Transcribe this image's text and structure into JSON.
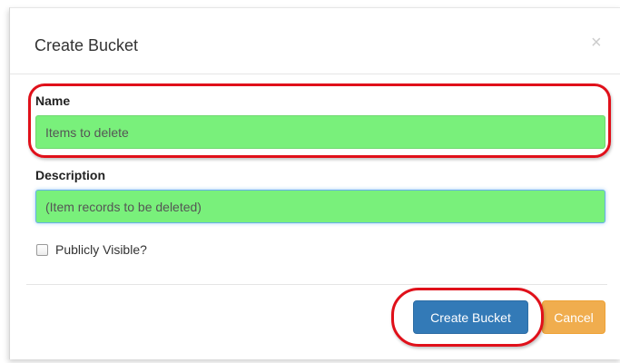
{
  "modal": {
    "title": "Create Bucket",
    "close_glyph": "×"
  },
  "form": {
    "name": {
      "label": "Name",
      "value": "Items to delete"
    },
    "description": {
      "label": "Description",
      "value": "(Item records to be deleted)"
    },
    "public": {
      "label": "Publicly Visible?",
      "checked": false
    }
  },
  "footer": {
    "create_label": "Create Bucket",
    "cancel_label": "Cancel"
  },
  "colors": {
    "field_fill": "#79f07b",
    "primary": "#337ab7",
    "warning": "#f0ad4e",
    "highlight": "#e0101a"
  }
}
